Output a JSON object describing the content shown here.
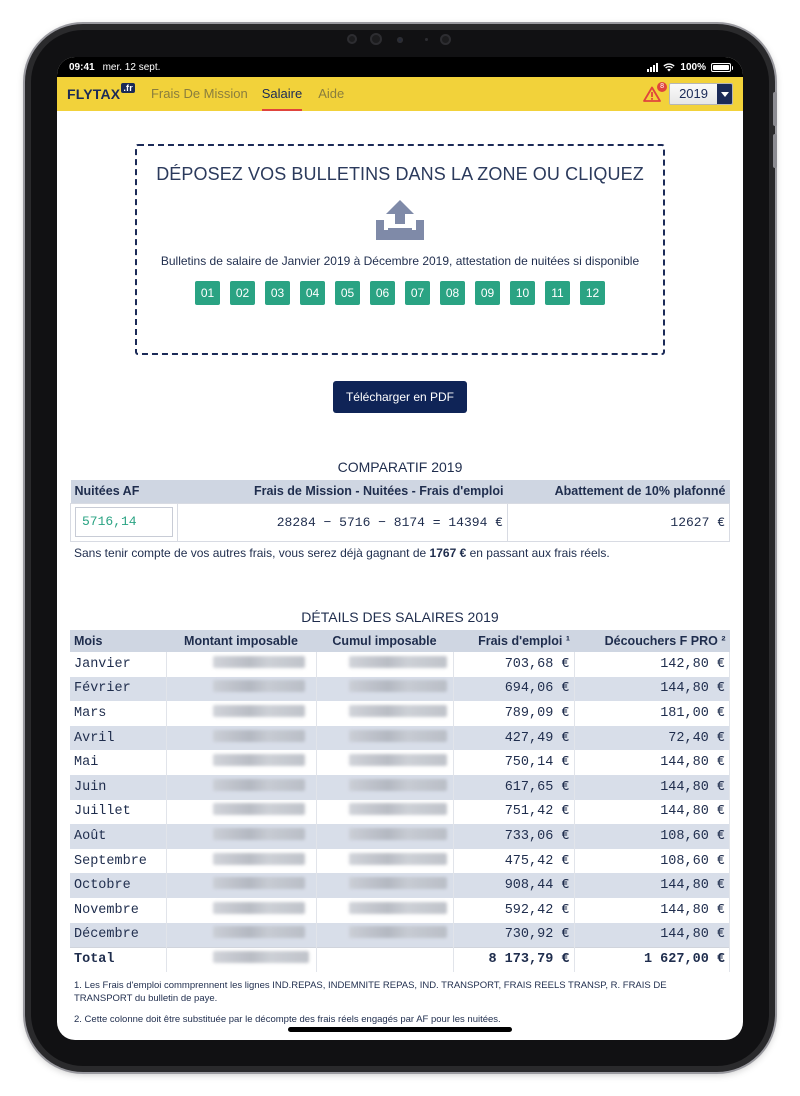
{
  "status": {
    "time": "09:41",
    "date": "mer. 12 sept.",
    "battery": "100%",
    "battery_level": 1.0
  },
  "nav": {
    "brand": "FLYTAX",
    "brand_tld": ".fr",
    "items": [
      "Frais De Mission",
      "Salaire",
      "Aide"
    ],
    "active": "Salaire",
    "warning_count": "8",
    "year": "2019"
  },
  "dropzone": {
    "title": "DÉPOSEZ VOS BULLETINS DANS LA ZONE OU CLIQUEZ",
    "subtitle": "Bulletins de salaire de Janvier 2019 à Décembre 2019, attestation de nuitées si disponible",
    "months": [
      "01",
      "02",
      "03",
      "04",
      "05",
      "06",
      "07",
      "08",
      "09",
      "10",
      "11",
      "12"
    ]
  },
  "pdf_button": "Télécharger en PDF",
  "comparatif": {
    "title": "COMPARATIF 2019",
    "headers": [
      "Nuitées AF",
      "Frais de Mission - Nuitées - Frais d'emploi",
      "Abattement de 10% plafonné"
    ],
    "nuitees_value": "5716,14",
    "calculation": "28284 − 5716 − 8174 = 14394 €",
    "abattement": "12627 €",
    "note_before": "Sans tenir compte de vos autres frais, vous serez déjà gagnant de ",
    "note_amount": "1767 €",
    "note_after": " en passant aux frais réels."
  },
  "details": {
    "title": "DÉTAILS DES SALAIRES 2019",
    "headers": [
      "Mois",
      "Montant imposable",
      "Cumul imposable",
      "Frais d'emploi ¹",
      "Découchers F PRO ²"
    ],
    "rows": [
      {
        "mois": "Janvier",
        "frais": "703,68 €",
        "decouchers": "142,80 €"
      },
      {
        "mois": "Février",
        "frais": "694,06 €",
        "decouchers": "144,80 €"
      },
      {
        "mois": "Mars",
        "frais": "789,09 €",
        "decouchers": "181,00 €"
      },
      {
        "mois": "Avril",
        "frais": "427,49 €",
        "decouchers": "72,40 €"
      },
      {
        "mois": "Mai",
        "frais": "750,14 €",
        "decouchers": "144,80 €"
      },
      {
        "mois": "Juin",
        "frais": "617,65 €",
        "decouchers": "144,80 €"
      },
      {
        "mois": "Juillet",
        "frais": "751,42 €",
        "decouchers": "144,80 €"
      },
      {
        "mois": "Août",
        "frais": "733,06 €",
        "decouchers": "108,60 €"
      },
      {
        "mois": "Septembre",
        "frais": "475,42 €",
        "decouchers": "108,60 €"
      },
      {
        "mois": "Octobre",
        "frais": "908,44 €",
        "decouchers": "144,80 €"
      },
      {
        "mois": "Novembre",
        "frais": "592,42 €",
        "decouchers": "144,80 €"
      },
      {
        "mois": "Décembre",
        "frais": "730,92 €",
        "decouchers": "144,80 €"
      }
    ],
    "total": {
      "label": "Total",
      "frais": "8 173,79 €",
      "decouchers": "1 627,00 €"
    }
  },
  "footnotes": [
    "1. Les Frais d'emploi commprennent les lignes IND.REPAS, INDEMNITE REPAS, IND. TRANSPORT, FRAIS REELS TRANSP, R. FRAIS DE TRANSPORT du bulletin de paye.",
    "2. Cette colonne doit être substituée par le décompte des frais réels engagés par AF pour les nuitées."
  ]
}
